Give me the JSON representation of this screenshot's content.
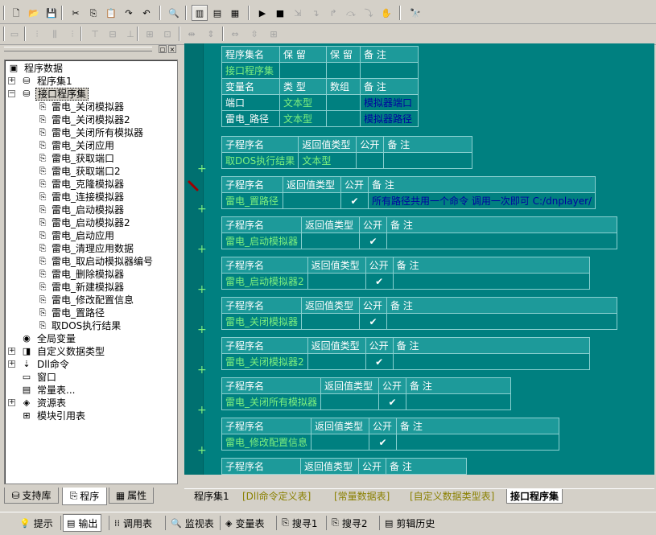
{
  "toolbar1": {
    "buttons": [
      {
        "icon": "new-file-icon",
        "glyph": "🗋"
      },
      {
        "icon": "open-folder-icon",
        "glyph": "📂"
      },
      {
        "icon": "save-icon",
        "glyph": "💾"
      },
      {
        "icon": "cut-icon",
        "glyph": "✂"
      },
      {
        "icon": "copy-icon",
        "glyph": "⎘"
      },
      {
        "icon": "paste-icon",
        "glyph": "📋"
      },
      {
        "icon": "redo-icon",
        "glyph": "↷"
      },
      {
        "icon": "undo-icon",
        "glyph": "↶"
      },
      {
        "icon": "find-icon",
        "glyph": "🔍"
      },
      {
        "icon": "layout-left-icon",
        "glyph": "▥"
      },
      {
        "icon": "layout-top-icon",
        "glyph": "▤"
      },
      {
        "icon": "layout-full-icon",
        "glyph": "▦"
      },
      {
        "icon": "run-icon",
        "glyph": "▶"
      },
      {
        "icon": "stop-icon",
        "glyph": "■"
      },
      {
        "icon": "step-into-icon",
        "glyph": "⇲"
      },
      {
        "icon": "step-over-icon",
        "glyph": "↴"
      },
      {
        "icon": "step-out-icon",
        "glyph": "↱"
      },
      {
        "icon": "run-to-cursor-icon",
        "glyph": "⤼"
      },
      {
        "icon": "break-icon",
        "glyph": "⤵"
      },
      {
        "icon": "hand-icon",
        "glyph": "✋"
      },
      {
        "icon": "inspect-icon",
        "glyph": "🔭"
      }
    ]
  },
  "toolbar2": {
    "buttons": [
      {
        "icon": "form-icon",
        "glyph": "▭"
      },
      {
        "icon": "align-left-icon",
        "glyph": "⫶"
      },
      {
        "icon": "align-center-h-icon",
        "glyph": "⫼"
      },
      {
        "icon": "align-right-icon",
        "glyph": "⫶"
      },
      {
        "icon": "align-top-icon",
        "glyph": "⊤"
      },
      {
        "icon": "align-middle-icon",
        "glyph": "⊟"
      },
      {
        "icon": "align-bottom-icon",
        "glyph": "⊥"
      },
      {
        "icon": "same-width-icon",
        "glyph": "⊞"
      },
      {
        "icon": "same-height-icon",
        "glyph": "⊡"
      },
      {
        "icon": "h-space-icon",
        "glyph": "⇹"
      },
      {
        "icon": "v-space-icon",
        "glyph": "⇕"
      },
      {
        "icon": "center-h-icon",
        "glyph": "⇔"
      },
      {
        "icon": "center-v-icon",
        "glyph": "⇳"
      },
      {
        "icon": "grid-icon",
        "glyph": "⊞"
      }
    ]
  },
  "left_panel": {
    "tree": [
      {
        "label": "程序数据",
        "icon": "program-data-icon",
        "glyph": "▣",
        "level": 0,
        "exp": ""
      },
      {
        "label": "程序集1",
        "icon": "assembly-icon",
        "glyph": "⛁",
        "level": 1,
        "exp": "+"
      },
      {
        "label": "接口程序集",
        "icon": "assembly-icon",
        "glyph": "⛁",
        "level": 1,
        "exp": "−",
        "selected": true
      },
      {
        "label": "雷电_关闭模拟器",
        "icon": "subroutine-icon",
        "glyph": "⎘",
        "level": 2
      },
      {
        "label": "雷电_关闭模拟器2",
        "icon": "subroutine-icon",
        "glyph": "⎘",
        "level": 2
      },
      {
        "label": "雷电_关闭所有模拟器",
        "icon": "subroutine-icon",
        "glyph": "⎘",
        "level": 2
      },
      {
        "label": "雷电_关闭应用",
        "icon": "subroutine-icon",
        "glyph": "⎘",
        "level": 2
      },
      {
        "label": "雷电_获取端口",
        "icon": "subroutine-icon",
        "glyph": "⎘",
        "level": 2
      },
      {
        "label": "雷电_获取端口2",
        "icon": "subroutine-icon",
        "glyph": "⎘",
        "level": 2
      },
      {
        "label": "雷电_克隆模拟器",
        "icon": "subroutine-icon",
        "glyph": "⎘",
        "level": 2
      },
      {
        "label": "雷电_连接模拟器",
        "icon": "subroutine-icon",
        "glyph": "⎘",
        "level": 2
      },
      {
        "label": "雷电_启动模拟器",
        "icon": "subroutine-icon",
        "glyph": "⎘",
        "level": 2
      },
      {
        "label": "雷电_启动模拟器2",
        "icon": "subroutine-icon",
        "glyph": "⎘",
        "level": 2
      },
      {
        "label": "雷电_启动应用",
        "icon": "subroutine-icon",
        "glyph": "⎘",
        "level": 2
      },
      {
        "label": "雷电_清理应用数据",
        "icon": "subroutine-icon",
        "glyph": "⎘",
        "level": 2
      },
      {
        "label": "雷电_取启动模拟器编号",
        "icon": "subroutine-icon",
        "glyph": "⎘",
        "level": 2
      },
      {
        "label": "雷电_删除模拟器",
        "icon": "subroutine-icon",
        "glyph": "⎘",
        "level": 2
      },
      {
        "label": "雷电_新建模拟器",
        "icon": "subroutine-icon",
        "glyph": "⎘",
        "level": 2
      },
      {
        "label": "雷电_修改配置信息",
        "icon": "subroutine-icon",
        "glyph": "⎘",
        "level": 2
      },
      {
        "label": "雷电_置路径",
        "icon": "subroutine-icon",
        "glyph": "⎘",
        "level": 2
      },
      {
        "label": "取DOS执行结果",
        "icon": "subroutine-icon",
        "glyph": "⎘",
        "level": 2
      },
      {
        "label": "全局变量",
        "icon": "global-var-icon",
        "glyph": "◉",
        "level": 1,
        "exp": ""
      },
      {
        "label": "自定义数据类型",
        "icon": "custom-type-icon",
        "glyph": "◨",
        "level": 1,
        "exp": "+"
      },
      {
        "label": "Dll命令",
        "icon": "dll-icon",
        "glyph": "⇣",
        "level": 1,
        "exp": "+"
      },
      {
        "label": "窗口",
        "icon": "window-icon",
        "glyph": "▭",
        "level": 1,
        "exp": ""
      },
      {
        "label": "常量表...",
        "icon": "constant-icon",
        "glyph": "▤",
        "level": 1,
        "exp": ""
      },
      {
        "label": "资源表",
        "icon": "resource-icon",
        "glyph": "◈",
        "level": 1,
        "exp": "+"
      },
      {
        "label": "模块引用表",
        "icon": "module-ref-icon",
        "glyph": "⊞",
        "level": 1,
        "exp": ""
      }
    ],
    "tabs": [
      {
        "label": "支持库",
        "icon": "library-icon",
        "glyph": "⛁"
      },
      {
        "label": "程序",
        "icon": "program-icon",
        "glyph": "⎘",
        "active": true
      },
      {
        "label": "属性",
        "icon": "property-icon",
        "glyph": "▦"
      }
    ]
  },
  "assembly_table": {
    "headers": [
      "程序集名",
      "保 留",
      "保 留",
      "备 注"
    ],
    "name": "接口程序集",
    "var_headers": [
      "变量名",
      "类 型",
      "数组",
      "备 注"
    ],
    "vars": [
      {
        "name": "端口",
        "type": "文本型",
        "array": "",
        "note": "模拟器端口"
      },
      {
        "name": "雷电_路径",
        "type": "文本型",
        "array": "",
        "note": "模拟器路径"
      }
    ]
  },
  "subroutines": {
    "headers": [
      "子程序名",
      "返回值类型",
      "公开",
      "备 注"
    ],
    "items": [
      {
        "name": "取DOS执行结果",
        "ret": "文本型",
        "public": "",
        "note": ""
      },
      {
        "name": "雷电_置路径",
        "ret": "",
        "public": "✔",
        "note": "所有路径共用一个命令 调用一次即可 C:/dnplayer/"
      },
      {
        "name": "雷电_启动模拟器",
        "ret": "",
        "public": "✔",
        "note": ""
      },
      {
        "name": "雷电_启动模拟器2",
        "ret": "",
        "public": "✔",
        "note": ""
      },
      {
        "name": "雷电_关闭模拟器",
        "ret": "",
        "public": "✔",
        "note": ""
      },
      {
        "name": "雷电_关闭模拟器2",
        "ret": "",
        "public": "✔",
        "note": ""
      },
      {
        "name": "雷电_关闭所有模拟器",
        "ret": "",
        "public": "✔",
        "note": ""
      },
      {
        "name": "雷电_修改配置信息",
        "ret": "",
        "public": "✔",
        "note": ""
      },
      {
        "name": "",
        "ret": "",
        "public": "",
        "note": ""
      }
    ]
  },
  "file_tabs": [
    {
      "label": "程序集1",
      "dim": false
    },
    {
      "label": "[Dll命令定义表]",
      "dim": true
    },
    {
      "label": "[常量数据表]",
      "dim": true
    },
    {
      "label": "[自定义数据类型表]",
      "dim": true
    },
    {
      "label": "接口程序集",
      "active": true
    }
  ],
  "bottom_tabs": [
    {
      "label": "提示",
      "icon": "tip-icon",
      "glyph": "💡"
    },
    {
      "label": "输出",
      "icon": "output-icon",
      "glyph": "▤",
      "active": true
    },
    {
      "label": "调用表",
      "icon": "callstack-icon",
      "glyph": "⁞⁞"
    },
    {
      "label": "监视表",
      "icon": "watch-icon",
      "glyph": "🔍"
    },
    {
      "label": "变量表",
      "icon": "variables-icon",
      "glyph": "◈"
    },
    {
      "label": "搜寻1",
      "icon": "search1-icon",
      "glyph": "⎘"
    },
    {
      "label": "搜寻2",
      "icon": "search2-icon",
      "glyph": "⎘"
    },
    {
      "label": "剪辑历史",
      "icon": "clip-history-icon",
      "glyph": "▤"
    }
  ]
}
